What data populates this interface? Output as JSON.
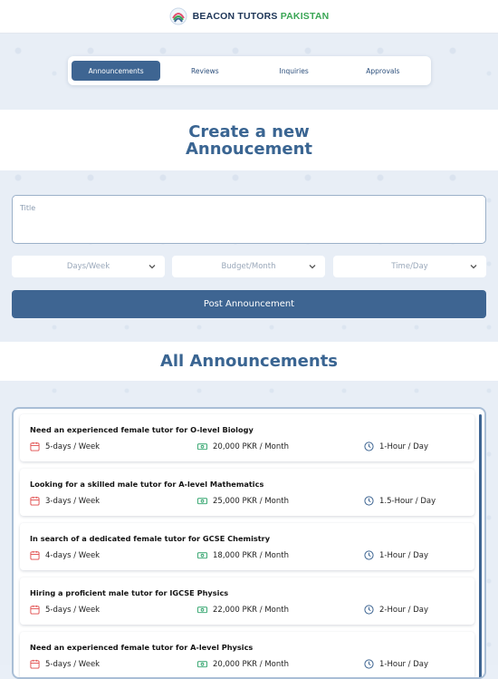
{
  "brand": {
    "name_main": "BEACON TUTORS",
    "name_accent": "PAKISTAN"
  },
  "tabs": [
    {
      "label": "Announcements",
      "active": true
    },
    {
      "label": "Reviews",
      "active": false
    },
    {
      "label": "Inquiries",
      "active": false
    },
    {
      "label": "Approvals",
      "active": false
    }
  ],
  "create": {
    "heading": "Create a new Annoucement",
    "title_placeholder": "Title",
    "days_placeholder": "Days/Week",
    "budget_placeholder": "Budget/Month",
    "time_placeholder": "Time/Day",
    "post_label": "Post Announcement"
  },
  "all": {
    "heading": "All Announcements",
    "items": [
      {
        "title": "Need an experienced female tutor for O-level Biology",
        "days": "5-days / Week",
        "budget": "20,000 PKR / Month",
        "time": "1-Hour / Day"
      },
      {
        "title": "Looking for a skilled male tutor for A-level Mathematics",
        "days": "3-days / Week",
        "budget": "25,000 PKR / Month",
        "time": "1.5-Hour / Day"
      },
      {
        "title": "In search of a dedicated female tutor for GCSE Chemistry",
        "days": "4-days / Week",
        "budget": "18,000 PKR / Month",
        "time": "1-Hour / Day"
      },
      {
        "title": "Hiring a proficient male tutor for IGCSE Physics",
        "days": "5-days / Week",
        "budget": "22,000 PKR / Month",
        "time": "2-Hour / Day"
      },
      {
        "title": "Need an experienced female tutor for A-level Physics",
        "days": "5-days / Week",
        "budget": "20,000 PKR / Month",
        "time": "1-Hour / Day"
      }
    ]
  },
  "colors": {
    "primary": "#3e6592",
    "heading": "#3a6592",
    "accent_green": "#3aa655",
    "icon_red": "#e04a4a",
    "icon_green": "#2fa36b",
    "icon_blue": "#3e6592"
  },
  "icons": {
    "days": "calendar-icon",
    "budget": "money-icon",
    "time": "clock-icon",
    "dropdown": "chevron-down-icon"
  }
}
